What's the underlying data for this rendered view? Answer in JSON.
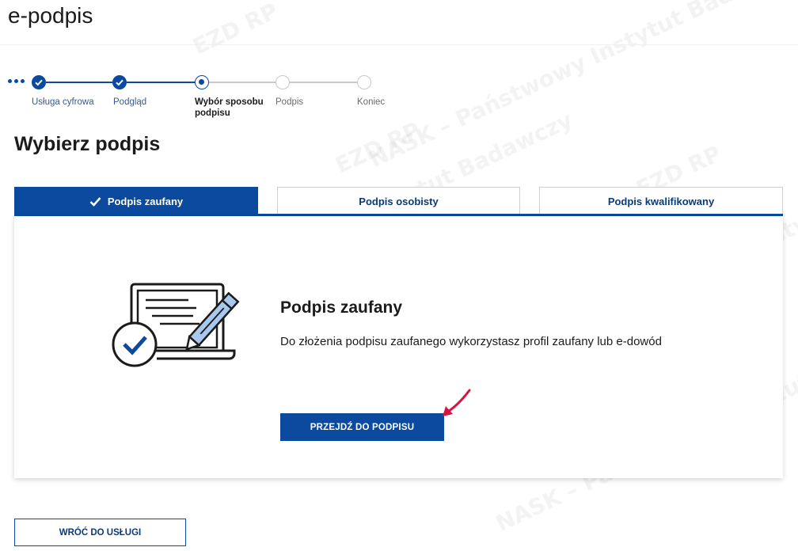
{
  "app": {
    "title": "e-podpis"
  },
  "stepper": {
    "steps": [
      {
        "label": "Usługa cyfrowa",
        "state": "done"
      },
      {
        "label": "Podgląd",
        "state": "done"
      },
      {
        "label": "Wybór sposobu podpisu",
        "state": "current"
      },
      {
        "label": "Podpis",
        "state": "todo"
      },
      {
        "label": "Koniec",
        "state": "todo"
      }
    ]
  },
  "page": {
    "heading": "Wybierz podpis"
  },
  "tabs": [
    {
      "label": "Podpis zaufany",
      "active": true
    },
    {
      "label": "Podpis osobisty",
      "active": false
    },
    {
      "label": "Podpis kwalifikowany",
      "active": false
    }
  ],
  "panel": {
    "title": "Podpis zaufany",
    "description": "Do złożenia podpisu zaufanego wykorzystasz profil zaufany lub e-dowód",
    "primary_button": "PRZEJDŹ DO PODPISU"
  },
  "footer": {
    "back_button": "WRÓĆ DO USŁUGI"
  },
  "watermark": {
    "texts": [
      "EZD RP",
      "NASK – Państwowy Instytut Badawczy"
    ]
  },
  "colors": {
    "primary": "#0b4a9e",
    "annotation": "#d5173f"
  },
  "icons": [
    "more-steps-icon",
    "check-icon",
    "laptop-signature-icon",
    "red-arrow-icon"
  ]
}
